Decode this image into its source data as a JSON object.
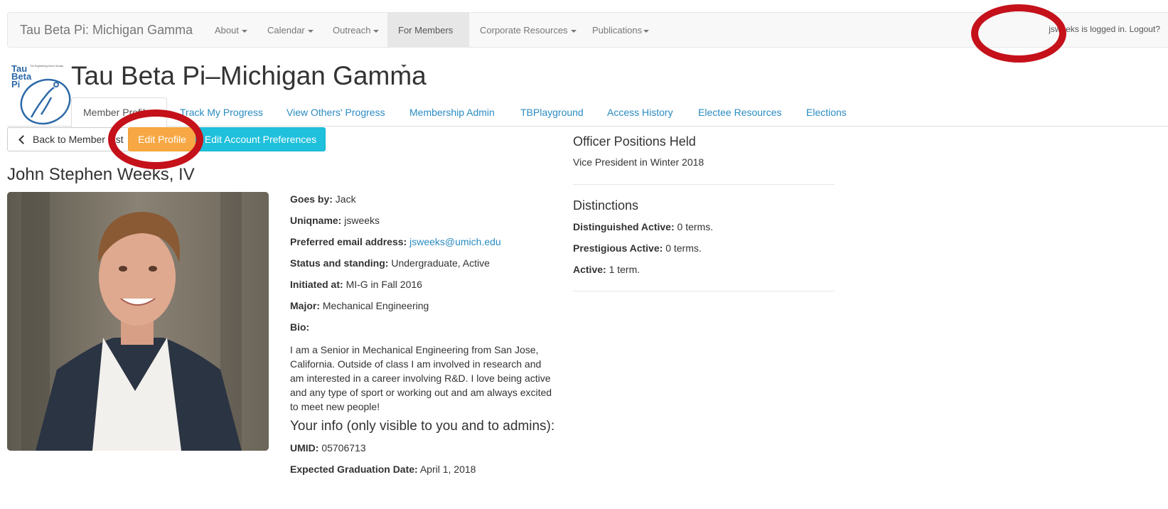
{
  "navbar": {
    "brand": "Tau Beta Pi: Michigan Gamma",
    "items": [
      {
        "label": "About",
        "active": false
      },
      {
        "label": "Calendar",
        "active": false
      },
      {
        "label": "Outreach",
        "active": false
      },
      {
        "label": "For Members",
        "active": true
      },
      {
        "label": "Corporate Resources",
        "active": false
      },
      {
        "label": "Publications",
        "active": false
      }
    ],
    "user_status": "jsweeks is logged in.",
    "logout_label": "Logout?"
  },
  "header": {
    "logo_text_lines": [
      "Tau",
      "Beta",
      "Pi"
    ],
    "logo_tagline": "The Engineering Honor Society",
    "title": "Tau Beta Pi–Michigan Gamma"
  },
  "tabs": [
    {
      "label": "Member Profile",
      "active": true
    },
    {
      "label": "Track My Progress",
      "active": false
    },
    {
      "label": "View Others' Progress",
      "active": false
    },
    {
      "label": "Membership Admin",
      "active": false
    },
    {
      "label": "TBPlayground",
      "active": false
    },
    {
      "label": "Access History",
      "active": false
    },
    {
      "label": "Electee Resources",
      "active": false
    },
    {
      "label": "Elections",
      "active": false
    }
  ],
  "actions": {
    "back_label": "Back to Member List",
    "edit_profile_label": "Edit Profile",
    "edit_prefs_label": "Edit Account Preferences"
  },
  "member": {
    "name": "John Stephen Weeks, IV",
    "photo_alt": "Member photo",
    "fields": [
      {
        "label": "Goes by:",
        "value": "Jack",
        "link": false
      },
      {
        "label": "Uniqname:",
        "value": "jsweeks",
        "link": false
      },
      {
        "label": "Preferred email address:",
        "value": "jsweeks@umich.edu",
        "link": true
      },
      {
        "label": "Status and standing:",
        "value": "Undergraduate, Active",
        "link": false
      },
      {
        "label": "Initiated at:",
        "value": "MI-G in Fall 2016",
        "link": false
      },
      {
        "label": "Major:",
        "value": "Mechanical Engineering",
        "link": false
      },
      {
        "label": "Bio:",
        "value": "",
        "link": false
      }
    ],
    "bio": "I am a Senior in Mechanical Engineering from San Jose, California. Outside of class I am involved in research and am interested in a career involving R&D. I love being active and any type of sport or working out and am always excited to meet new people!",
    "private_heading": "Your info (only visible to you and to admins):",
    "private_fields": [
      {
        "label": "UMID:",
        "value": "05706713"
      },
      {
        "label": "Expected Graduation Date:",
        "value": "April 1, 2018"
      }
    ]
  },
  "officer": {
    "heading": "Officer Positions Held",
    "positions": [
      "Vice President in Winter 2018"
    ]
  },
  "distinctions": {
    "heading": "Distinctions",
    "items": [
      {
        "label": "Distinguished Active:",
        "value": "0 terms."
      },
      {
        "label": "Prestigious Active:",
        "value": "0 terms."
      },
      {
        "label": "Active:",
        "value": "1 term."
      }
    ]
  },
  "colors": {
    "link": "#2a8bc2",
    "warning_button": "#f7a845",
    "info_button": "#1fc0dc",
    "annotation_circle": "#c5111a"
  }
}
